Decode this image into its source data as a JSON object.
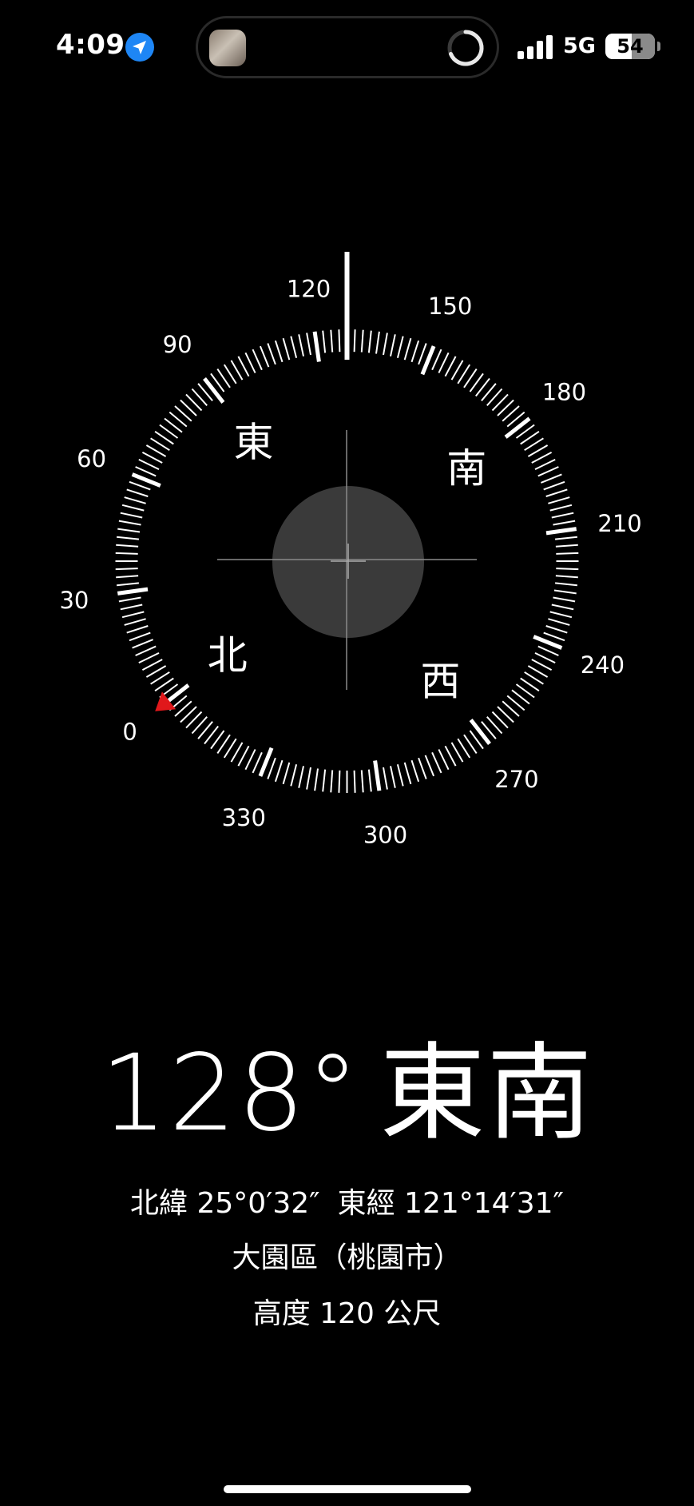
{
  "status_bar": {
    "time": "4:09",
    "network": "5G",
    "battery": "54",
    "battery_fraction": 0.54,
    "location_icon": "location-arrow-icon",
    "signal_icon": "cellular-signal-icon"
  },
  "dynamic_island": {
    "thumbnail_icon": "now-playing-thumbnail",
    "activity_icon": "progress-ring-icon"
  },
  "compass": {
    "heading_value": 128,
    "degree_labels": [
      "0",
      "30",
      "60",
      "90",
      "120",
      "150",
      "180",
      "210",
      "240",
      "270",
      "300",
      "330"
    ],
    "cardinals": {
      "north": "北",
      "east": "東",
      "south": "南",
      "west": "西"
    },
    "north_marker_color": "#e0181b"
  },
  "readout": {
    "heading": "128°",
    "direction": "東南",
    "latitude": "北緯 25°0′32″",
    "longitude": "東經 121°14′31″",
    "place": "大園區（桃園市）",
    "altitude": "高度 120 公尺"
  }
}
